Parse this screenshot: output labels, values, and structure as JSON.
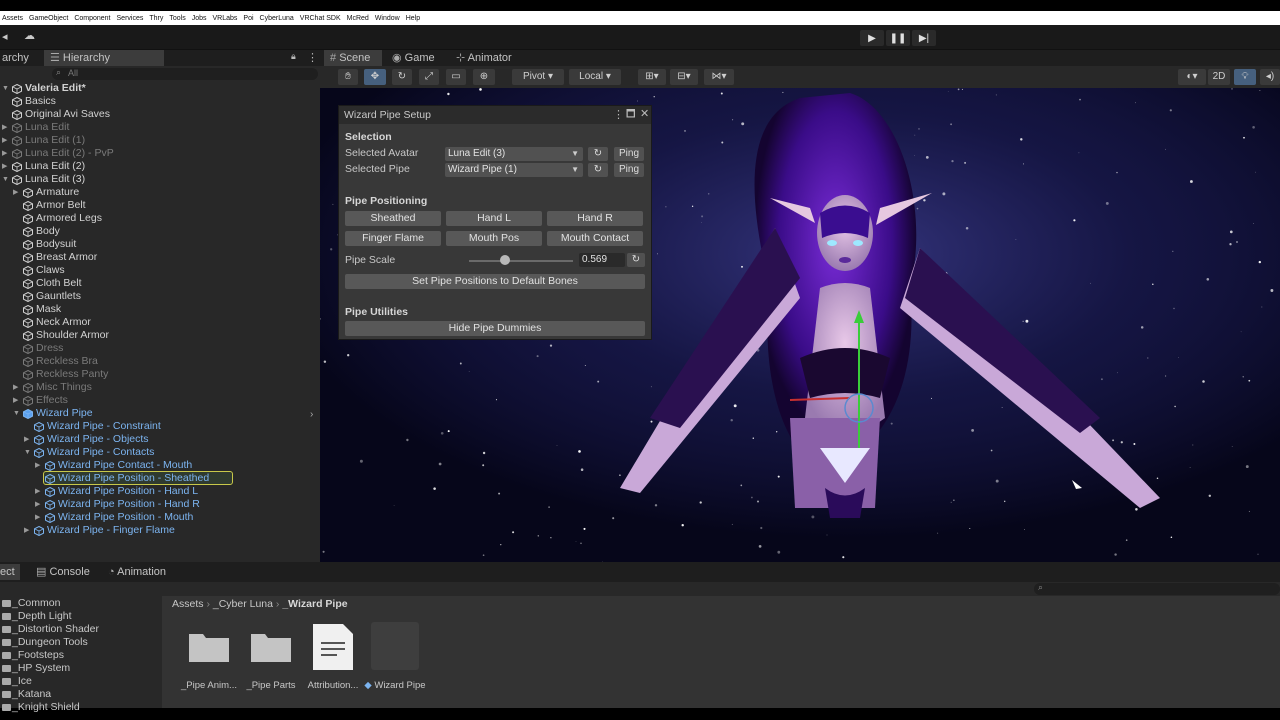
{
  "menubar": [
    "Assets",
    "GameObject",
    "Component",
    "Services",
    "Thry",
    "Tools",
    "Jobs",
    "VRLabs",
    "Poi",
    "CyberLuna",
    "VRChat SDK",
    "McRed",
    "Window",
    "Help"
  ],
  "colors": {
    "accent_blue": "#7cb4f0",
    "selection_outline": "#c8c84a",
    "panel_bg": "#282828",
    "wizard_bg": "#383838"
  },
  "hierarchy": {
    "tab_left_partial": "archy",
    "tab": "Hierarchy",
    "search_placeholder": "All",
    "rows": [
      {
        "label": "Valeria Edit*",
        "depth": 0,
        "style": "norm",
        "arrow": "down",
        "bold": true
      },
      {
        "label": "Basics",
        "depth": 0,
        "style": "norm",
        "arrow": "none"
      },
      {
        "label": "Original Avi Saves",
        "depth": 0,
        "style": "norm",
        "arrow": "none"
      },
      {
        "label": "Luna Edit",
        "depth": 0,
        "style": "dim",
        "arrow": "right"
      },
      {
        "label": "Luna Edit (1)",
        "depth": 0,
        "style": "dim",
        "arrow": "right"
      },
      {
        "label": "Luna Edit (2) - PvP",
        "depth": 0,
        "style": "dim",
        "arrow": "right"
      },
      {
        "label": "Luna Edit (2)",
        "depth": 0,
        "style": "norm",
        "arrow": "right"
      },
      {
        "label": "Luna Edit (3)",
        "depth": 0,
        "style": "norm",
        "arrow": "down"
      },
      {
        "label": "Armature",
        "depth": 1,
        "style": "norm",
        "arrow": "right"
      },
      {
        "label": "Armor Belt",
        "depth": 1,
        "style": "norm",
        "arrow": "none"
      },
      {
        "label": "Armored Legs",
        "depth": 1,
        "style": "norm",
        "arrow": "none"
      },
      {
        "label": "Body",
        "depth": 1,
        "style": "norm",
        "arrow": "none"
      },
      {
        "label": "Bodysuit",
        "depth": 1,
        "style": "norm",
        "arrow": "none"
      },
      {
        "label": "Breast Armor",
        "depth": 1,
        "style": "norm",
        "arrow": "none"
      },
      {
        "label": "Claws",
        "depth": 1,
        "style": "norm",
        "arrow": "none"
      },
      {
        "label": "Cloth Belt",
        "depth": 1,
        "style": "norm",
        "arrow": "none"
      },
      {
        "label": "Gauntlets",
        "depth": 1,
        "style": "norm",
        "arrow": "none"
      },
      {
        "label": "Mask",
        "depth": 1,
        "style": "norm",
        "arrow": "none"
      },
      {
        "label": "Neck Armor",
        "depth": 1,
        "style": "norm",
        "arrow": "none"
      },
      {
        "label": "Shoulder Armor",
        "depth": 1,
        "style": "norm",
        "arrow": "none"
      },
      {
        "label": "Dress",
        "depth": 1,
        "style": "dim",
        "arrow": "none"
      },
      {
        "label": "Reckless Bra",
        "depth": 1,
        "style": "dim",
        "arrow": "none"
      },
      {
        "label": "Reckless Panty",
        "depth": 1,
        "style": "dim",
        "arrow": "none"
      },
      {
        "label": "Misc Things",
        "depth": 1,
        "style": "dim",
        "arrow": "right"
      },
      {
        "label": "Effects",
        "depth": 1,
        "style": "dim",
        "arrow": "right"
      },
      {
        "label": "Wizard Pipe",
        "depth": 1,
        "style": "blue",
        "arrow": "down",
        "prefab": true
      },
      {
        "label": "Wizard Pipe - Constraint",
        "depth": 2,
        "style": "blue",
        "arrow": "none"
      },
      {
        "label": "Wizard Pipe - Objects",
        "depth": 2,
        "style": "blue",
        "arrow": "right"
      },
      {
        "label": "Wizard Pipe - Contacts",
        "depth": 2,
        "style": "blue",
        "arrow": "down"
      },
      {
        "label": "Wizard Pipe Contact - Mouth",
        "depth": 3,
        "style": "blue",
        "arrow": "right"
      },
      {
        "label": "Wizard Pipe Position - Sheathed",
        "depth": 3,
        "style": "blue",
        "arrow": "none",
        "selected": true
      },
      {
        "label": "Wizard Pipe Position - Hand L",
        "depth": 3,
        "style": "blue",
        "arrow": "right"
      },
      {
        "label": "Wizard Pipe Position - Hand R",
        "depth": 3,
        "style": "blue",
        "arrow": "right"
      },
      {
        "label": "Wizard Pipe Position - Mouth",
        "depth": 3,
        "style": "blue",
        "arrow": "right"
      },
      {
        "label": "Wizard Pipe - Finger Flame",
        "depth": 2,
        "style": "blue",
        "arrow": "right"
      }
    ]
  },
  "scene": {
    "tabs": [
      "Scene",
      "Game",
      "Animator"
    ],
    "pivot": "Pivot",
    "local": "Local",
    "mode_2d": "2D"
  },
  "wizard": {
    "title": "Wizard Pipe Setup",
    "selection_header": "Selection",
    "avatar_label": "Selected Avatar",
    "avatar_value": "Luna Edit (3)",
    "pipe_label": "Selected Pipe",
    "pipe_value": "Wizard Pipe (1)",
    "ping": "Ping",
    "positioning_header": "Pipe Positioning",
    "buttons_row1": [
      "Sheathed",
      "Hand L",
      "Hand R"
    ],
    "buttons_row2": [
      "Finger Flame",
      "Mouth Pos",
      "Mouth Contact"
    ],
    "scale_label": "Pipe Scale",
    "scale_value": "0.569",
    "scale_fraction": 0.569,
    "default_bones_button": "Set Pipe Positions to Default Bones",
    "utilities_header": "Pipe Utilities",
    "hide_dummies_button": "Hide Pipe Dummies"
  },
  "bottom": {
    "tab_partial": "ect",
    "tabs": [
      "Console",
      "Animation"
    ],
    "breadcrumb": [
      "Assets",
      "_Cyber Luna",
      "_Wizard Pipe"
    ],
    "folders": [
      "_Common",
      "_Depth Light",
      "_Distortion Shader",
      "_Dungeon Tools",
      "_Footsteps",
      "_HP System",
      "_Ice",
      "_Katana",
      "_Knight Shield"
    ],
    "assets": [
      {
        "label": "_Pipe Anim...",
        "kind": "folder"
      },
      {
        "label": "_Pipe Parts",
        "kind": "folder"
      },
      {
        "label": "Attribution...",
        "kind": "doc"
      },
      {
        "label": "Wizard Pipe",
        "kind": "prefab"
      }
    ]
  }
}
